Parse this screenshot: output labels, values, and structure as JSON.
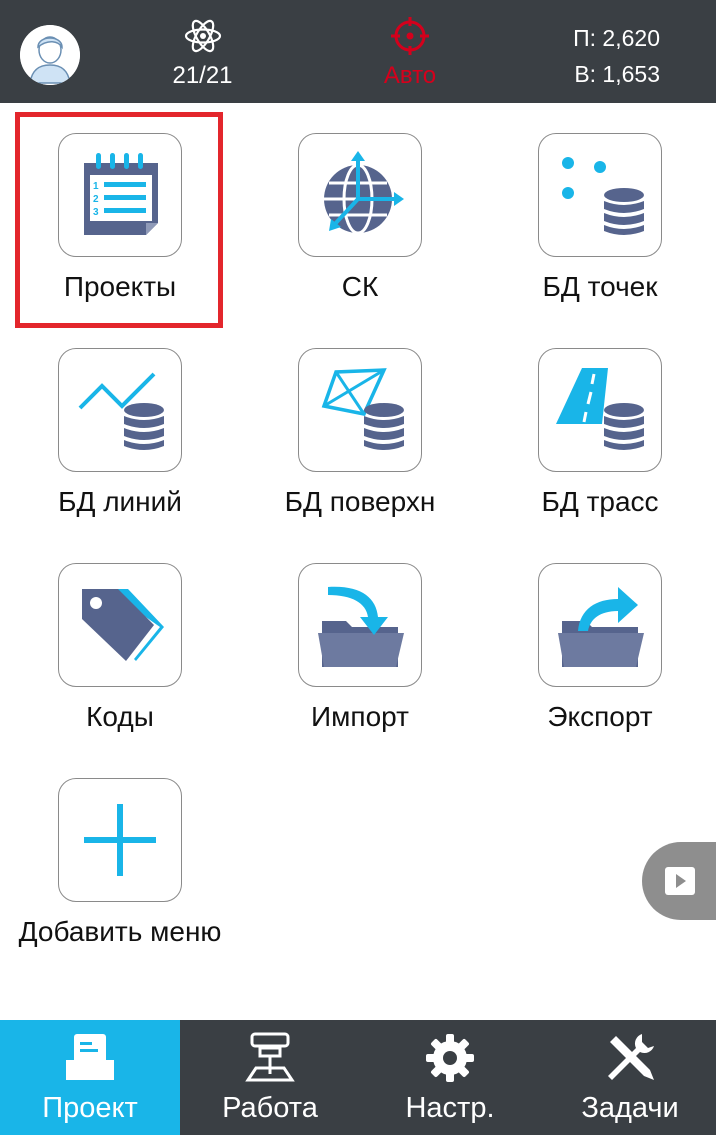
{
  "status_bar": {
    "satellites": "21/21",
    "mode": "Авто",
    "precision_h": "П: 2,620",
    "precision_v": "В: 1,653",
    "colors": {
      "bar_bg": "#3a3f44",
      "mode_red": "#d5001c"
    }
  },
  "menu": {
    "tiles": [
      {
        "label": "Проекты",
        "icon": "project-list-icon",
        "selected": true
      },
      {
        "label": "СК",
        "icon": "coordinate-system-globe-icon"
      },
      {
        "label": "БД точек",
        "icon": "points-database-icon"
      },
      {
        "label": "БД линий",
        "icon": "lines-database-icon"
      },
      {
        "label": "БД поверхн",
        "icon": "surfaces-database-icon"
      },
      {
        "label": "БД трасс",
        "icon": "roads-database-icon"
      },
      {
        "label": "Коды",
        "icon": "codes-tag-icon"
      },
      {
        "label": "Импорт",
        "icon": "import-folder-icon"
      },
      {
        "label": "Экспорт",
        "icon": "export-folder-icon"
      },
      {
        "label": "Добавить меню",
        "icon": "add-plus-icon"
      }
    ],
    "colors": {
      "icon_dark": "#56648d",
      "icon_accent": "#19b5e8",
      "selection": "#e3262c"
    }
  },
  "bottom_nav": {
    "items": [
      {
        "label": "Проект",
        "icon": "project-tray-icon",
        "active": true
      },
      {
        "label": "Работа",
        "icon": "survey-rover-icon"
      },
      {
        "label": "Настр.",
        "icon": "gear-icon"
      },
      {
        "label": "Задачи",
        "icon": "tools-wrench-icon"
      }
    ],
    "colors": {
      "active_bg": "#19b5e8"
    }
  }
}
